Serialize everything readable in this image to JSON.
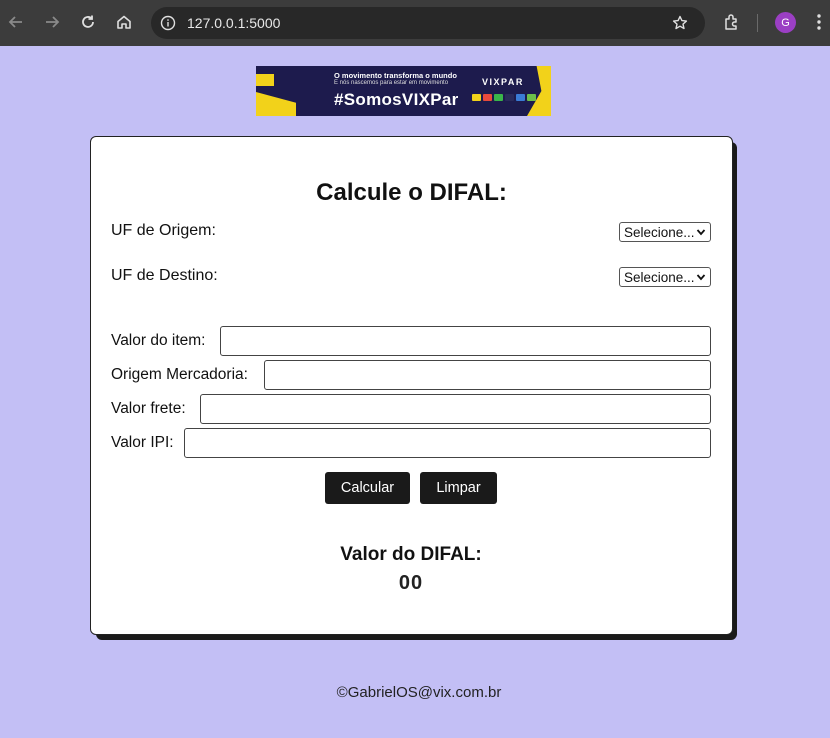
{
  "browser": {
    "url": "127.0.0.1:5000",
    "avatar_initial": "G"
  },
  "banner": {
    "tagline_1": "O movimento transforma o mundo",
    "tagline_2": "E nós nascemos para estar em movimento",
    "hashtag": "#SomosVIXPar",
    "brand": "VIXPAR",
    "accent_color": "#f2d21a",
    "background_color": "#1d1b4d"
  },
  "form": {
    "title": "Calcule o DIFAL:",
    "uf_origem_label": "UF de Origem:",
    "uf_origem_selected": "Selecione...",
    "uf_destino_label": "UF de Destino:",
    "uf_destino_selected": "Selecione...",
    "valor_item_label": "Valor do item:",
    "valor_item_value": "",
    "origem_mercadoria_label": "Origem Mercadoria:",
    "origem_mercadoria_value": "",
    "valor_frete_label": "Valor frete:",
    "valor_frete_value": "",
    "valor_ipi_label": "Valor IPI:",
    "valor_ipi_value": "",
    "calcular_label": "Calcular",
    "limpar_label": "Limpar"
  },
  "result": {
    "label": "Valor do DIFAL:",
    "value": "00"
  },
  "footer": {
    "text": "©GabrielOS@vix.com.br"
  },
  "colors": {
    "page_background": "#c3bff5",
    "button": "#1a1a1a"
  }
}
